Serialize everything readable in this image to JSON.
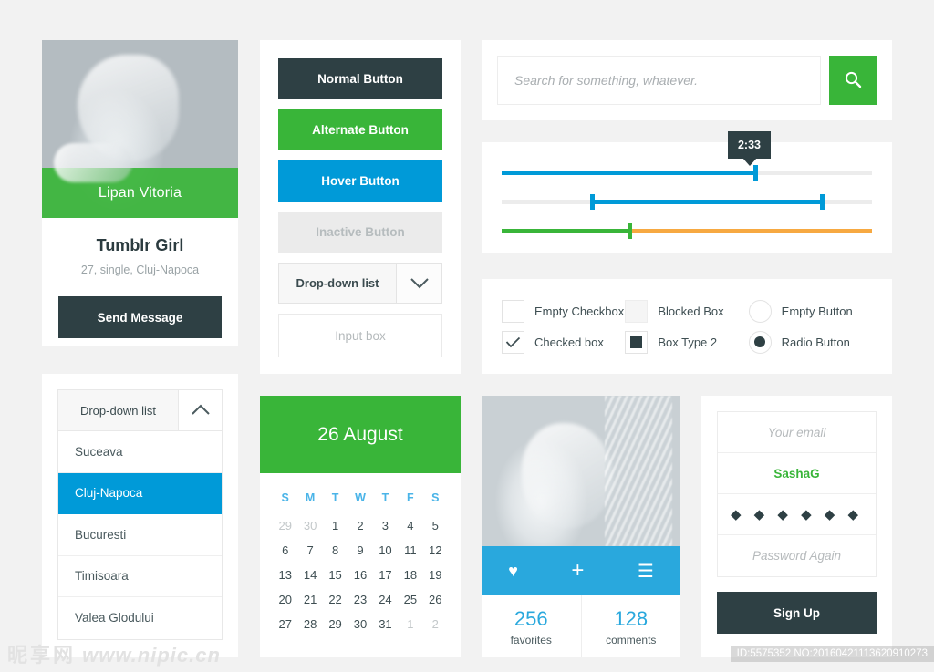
{
  "colors": {
    "background": "#f2f2f2",
    "dark": "#2e4044",
    "green": "#39b539",
    "blue": "#009ad8",
    "light_blue": "#29a8dd",
    "orange": "#f7a941",
    "inactive": "#ebebeb",
    "muted_text": "#9aa3a6"
  },
  "profile": {
    "name": "Lipan Vitoria",
    "title": "Tumblr Girl",
    "details": "27, single, Cluj-Napoca",
    "button_label": "Send Message"
  },
  "buttons": {
    "normal": "Normal Button",
    "alternate": "Alternate Button",
    "hover": "Hover Button",
    "inactive": "Inactive Button",
    "dropdown_label": "Drop-down list",
    "dropdown_icon": "chevron-down-icon",
    "input_placeholder": "Input box",
    "input_value": ""
  },
  "search": {
    "placeholder": "Search for something, whatever.",
    "value": "",
    "button_icon": "search-icon"
  },
  "sliders": {
    "tooltip_value": "2:33",
    "rows": [
      {
        "name": "single-slider",
        "fill_color": "#009ad8",
        "fill_percent": 68,
        "handles": [
          68
        ]
      },
      {
        "name": "range-slider",
        "fill_color": "#009ad8",
        "range_start": 24,
        "range_end": 86,
        "handles": [
          24,
          86
        ]
      },
      {
        "name": "split-slider",
        "left_color": "#39b539",
        "right_color": "#f7a941",
        "split_percent": 34,
        "handles": [
          34
        ]
      }
    ]
  },
  "checkboxes": [
    {
      "label": "Empty Checkbox",
      "type": "checkbox",
      "state": "empty"
    },
    {
      "label": "Blocked Box",
      "type": "checkbox",
      "state": "blocked"
    },
    {
      "label": "Empty Button",
      "type": "radio",
      "state": "empty"
    },
    {
      "label": "Checked box",
      "type": "checkbox",
      "state": "checked"
    },
    {
      "label": "Box Type 2",
      "type": "checkbox",
      "state": "filled"
    },
    {
      "label": "Radio Button",
      "type": "radio",
      "state": "selected"
    }
  ],
  "dropdown_open": {
    "header_label": "Drop-down list",
    "header_icon": "chevron-up-icon",
    "items": [
      {
        "label": "Suceava",
        "selected": false
      },
      {
        "label": "Cluj-Napoca",
        "selected": true
      },
      {
        "label": "Bucuresti",
        "selected": false
      },
      {
        "label": "Timisoara",
        "selected": false
      },
      {
        "label": "Valea Glodului",
        "selected": false
      }
    ]
  },
  "calendar": {
    "title": "26 August",
    "day_headers": [
      "S",
      "M",
      "T",
      "W",
      "T",
      "F",
      "S"
    ],
    "days": [
      {
        "n": "29",
        "muted": true
      },
      {
        "n": "30",
        "muted": true
      },
      {
        "n": "1",
        "muted": false
      },
      {
        "n": "2",
        "muted": false
      },
      {
        "n": "3",
        "muted": false
      },
      {
        "n": "4",
        "muted": false
      },
      {
        "n": "5",
        "muted": false
      },
      {
        "n": "6",
        "muted": false
      },
      {
        "n": "7",
        "muted": false
      },
      {
        "n": "8",
        "muted": false
      },
      {
        "n": "9",
        "muted": false
      },
      {
        "n": "10",
        "muted": false
      },
      {
        "n": "11",
        "muted": false
      },
      {
        "n": "12",
        "muted": false
      },
      {
        "n": "13",
        "muted": false
      },
      {
        "n": "14",
        "muted": false
      },
      {
        "n": "15",
        "muted": false
      },
      {
        "n": "16",
        "muted": false
      },
      {
        "n": "17",
        "muted": false
      },
      {
        "n": "18",
        "muted": false
      },
      {
        "n": "19",
        "muted": false
      },
      {
        "n": "20",
        "muted": false
      },
      {
        "n": "21",
        "muted": false
      },
      {
        "n": "22",
        "muted": false
      },
      {
        "n": "23",
        "muted": false
      },
      {
        "n": "24",
        "muted": false
      },
      {
        "n": "25",
        "muted": false
      },
      {
        "n": "26",
        "muted": false
      },
      {
        "n": "27",
        "muted": false
      },
      {
        "n": "28",
        "muted": false
      },
      {
        "n": "29",
        "muted": false
      },
      {
        "n": "30",
        "muted": false
      },
      {
        "n": "31",
        "muted": false
      },
      {
        "n": "1",
        "muted": true
      },
      {
        "n": "2",
        "muted": true
      }
    ]
  },
  "photo_card": {
    "actions": [
      {
        "name": "favorite-icon",
        "glyph": "♥"
      },
      {
        "name": "add-icon",
        "glyph": "+"
      },
      {
        "name": "menu-icon",
        "glyph": "☰"
      }
    ],
    "stats": [
      {
        "number": "256",
        "label": "favorites"
      },
      {
        "number": "128",
        "label": "comments"
      }
    ]
  },
  "signup": {
    "email_placeholder": "Your email",
    "username_value": "SashaG",
    "password_masked": "◆ ◆ ◆ ◆ ◆ ◆",
    "password_again_placeholder": "Password Again",
    "button_label": "Sign Up"
  },
  "watermarks": {
    "left_cjk": "昵享网",
    "left_url": "www.nipic.cn",
    "right_id": "ID:5575352 NO:20160421113620910273"
  }
}
